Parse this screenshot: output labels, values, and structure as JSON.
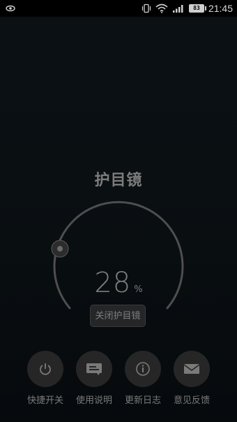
{
  "status_bar": {
    "time": "21:45",
    "battery": "83",
    "icons": [
      "eye-icon",
      "vibrate-icon",
      "wifi-icon",
      "signal-icon",
      "battery-icon"
    ]
  },
  "app": {
    "title": "护目镜",
    "level_value": "28",
    "level_unit": "%",
    "toggle_label": "关闭护目镜"
  },
  "menu": {
    "items": [
      {
        "label": "快捷开关",
        "icon": "power-icon"
      },
      {
        "label": "使用说明",
        "icon": "instructions-icon"
      },
      {
        "label": "更新日志",
        "icon": "info-icon"
      },
      {
        "label": "意见反馈",
        "icon": "mail-icon"
      }
    ]
  },
  "colors": {
    "background": "#0a0f12",
    "dial_arc": "#5a5a5a",
    "text": "#7c7c7c"
  }
}
